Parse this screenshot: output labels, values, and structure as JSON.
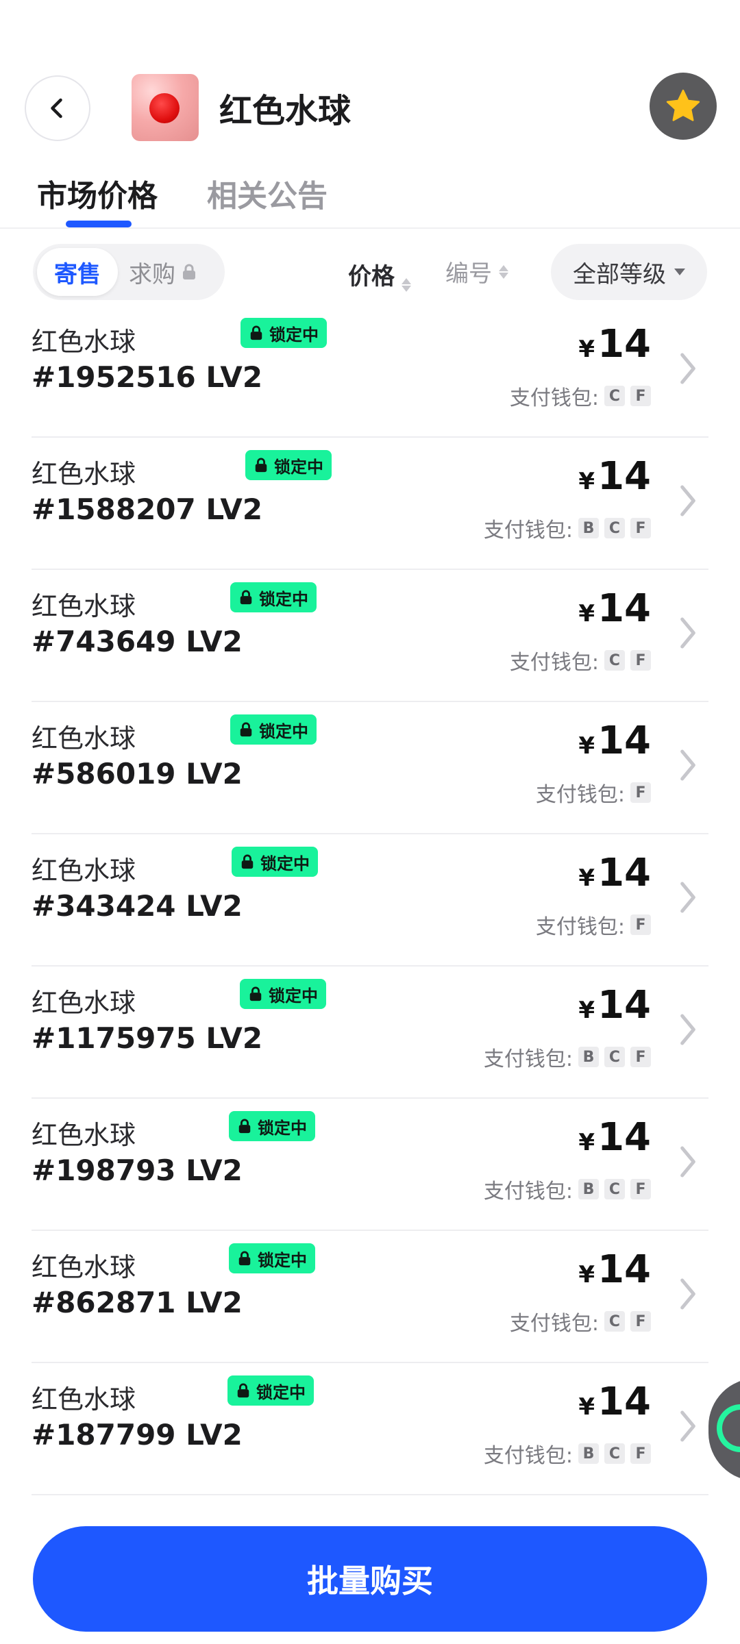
{
  "header": {
    "title": "红色水球"
  },
  "tabs": [
    {
      "label": "市场价格",
      "active": true
    },
    {
      "label": "相关公告",
      "active": false
    }
  ],
  "filters": {
    "mode_active": "寄售",
    "mode_other": "求购",
    "sort_price": "价格",
    "sort_number": "编号",
    "grade": "全部等级"
  },
  "lock_label": "锁定中",
  "currency_symbol": "¥",
  "wallet_label": "支付钱包:",
  "items": [
    {
      "name": "红色水球",
      "id": "#1952516 LV2",
      "price": "14",
      "wallets": [
        "C",
        "F"
      ]
    },
    {
      "name": "红色水球",
      "id": "#1588207 LV2",
      "price": "14",
      "wallets": [
        "B",
        "C",
        "F"
      ]
    },
    {
      "name": "红色水球",
      "id": "#743649 LV2",
      "price": "14",
      "wallets": [
        "C",
        "F"
      ]
    },
    {
      "name": "红色水球",
      "id": "#586019 LV2",
      "price": "14",
      "wallets": [
        "F"
      ]
    },
    {
      "name": "红色水球",
      "id": "#343424 LV2",
      "price": "14",
      "wallets": [
        "F"
      ]
    },
    {
      "name": "红色水球",
      "id": "#1175975 LV2",
      "price": "14",
      "wallets": [
        "B",
        "C",
        "F"
      ]
    },
    {
      "name": "红色水球",
      "id": "#198793 LV2",
      "price": "14",
      "wallets": [
        "B",
        "C",
        "F"
      ]
    },
    {
      "name": "红色水球",
      "id": "#862871 LV2",
      "price": "14",
      "wallets": [
        "C",
        "F"
      ]
    },
    {
      "name": "红色水球",
      "id": "#187799 LV2",
      "price": "14",
      "wallets": [
        "B",
        "C",
        "F"
      ]
    }
  ],
  "bottom_button": "批量购买",
  "colors": {
    "accent": "#1e58ff",
    "lock_badge": "#19f29b"
  }
}
